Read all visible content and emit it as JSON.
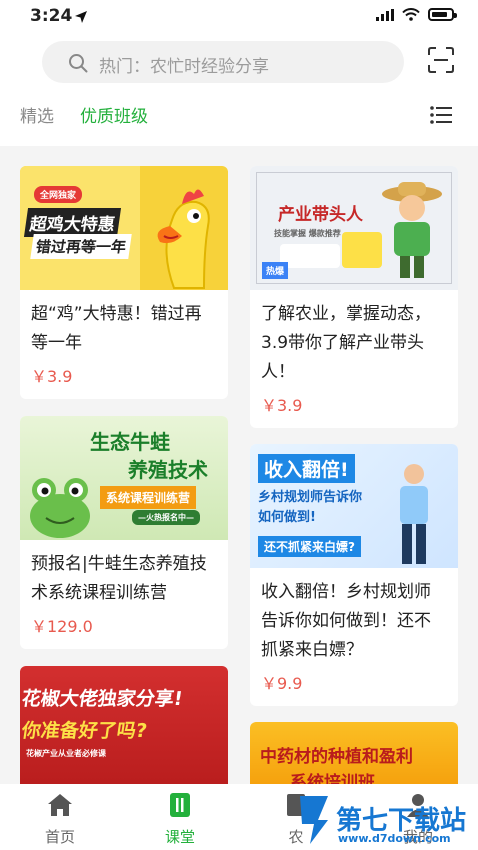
{
  "status": {
    "time": "3:24"
  },
  "search": {
    "placeholder": "热门：农忙时经验分享"
  },
  "tabs": [
    {
      "label": "精选"
    },
    {
      "label": "优质班级"
    }
  ],
  "colors": {
    "accent": "#23b03c",
    "price": "#e85a4f"
  },
  "courses": [
    {
      "title": "超“鸡”大特惠！错过再等一年",
      "price": "￥3.9",
      "thumb": {
        "tag": "全网独家",
        "line1": "超鸡大特惠",
        "line2": "错过再等一年"
      }
    },
    {
      "title": "了解农业，掌握动态，3.9带你了解产业带头人！",
      "price": "￥3.9",
      "thumb": {
        "line1": "产业带头人",
        "line2": "技能掌握 爆款推荐",
        "badge": "热爆"
      }
    },
    {
      "title": "预报名|牛蛙生态养殖技术系统课程训练营",
      "price": "￥129.0",
      "thumb": {
        "line1": "生态牛蛙",
        "line2": "养殖技术",
        "line3": "系统课程训练营",
        "line4": "—火热报名中—"
      }
    },
    {
      "title": "收入翻倍！乡村规划师告诉你如何做到！还不抓紧来白嫖？",
      "price": "￥9.9",
      "thumb": {
        "line1": "收入翻倍!",
        "line2": "乡村规划师告诉你",
        "line3": "如何做到!",
        "line4": "还不抓紧来白嫖?"
      }
    },
    {
      "title": "",
      "price": "",
      "thumb": {
        "line1": "花椒大佬独家分享!",
        "line2": "你准备好了吗?",
        "line3": "花椒产业从业者必修课"
      }
    },
    {
      "title": "",
      "price": "",
      "thumb": {
        "line1": "中药材的种植和盈利",
        "line2": "系统培训班"
      }
    }
  ],
  "tabbar": [
    {
      "label": "首页",
      "icon": "home-icon"
    },
    {
      "label": "课堂",
      "icon": "classroom-icon"
    },
    {
      "label": "农",
      "icon": "book-icon"
    },
    {
      "label": "我的",
      "icon": "user-icon"
    }
  ],
  "watermark": {
    "line1": "第七下载站",
    "line2": "www.d7down.com"
  }
}
